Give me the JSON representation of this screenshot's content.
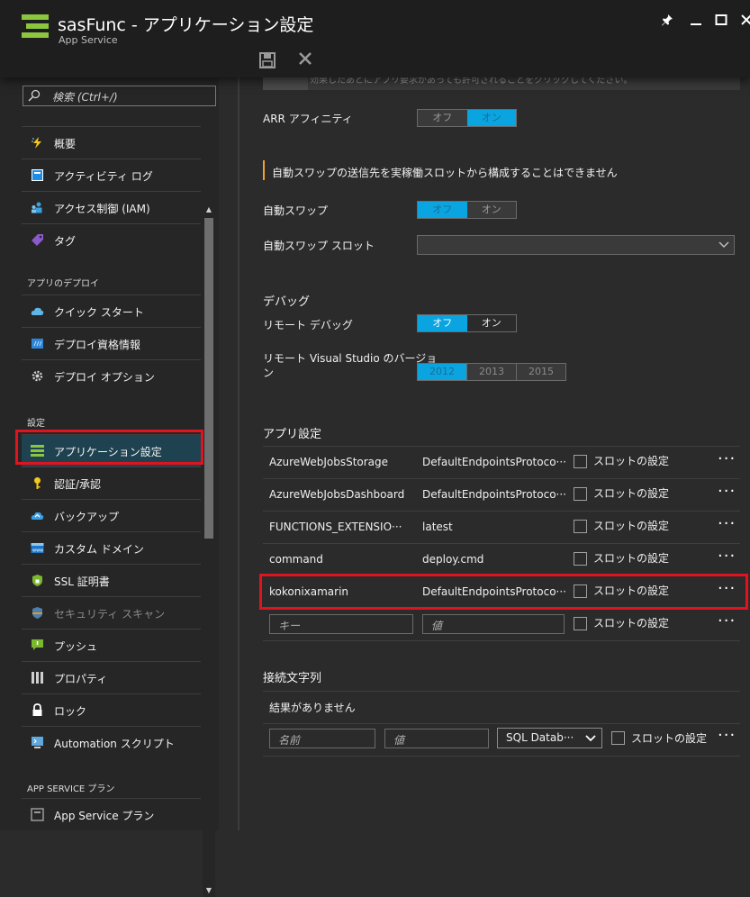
{
  "window": {
    "title": "sasFunc - アプリケーション設定",
    "subtitle": "App Service"
  },
  "search": {
    "placeholder": "検索 (Ctrl+/)"
  },
  "sidebar": {
    "items": [
      {
        "label": "概要",
        "icon": "lightning-icon"
      },
      {
        "label": "アクティビティ ログ",
        "icon": "activity-log-icon"
      },
      {
        "label": "アクセス制御 (IAM)",
        "icon": "users-icon"
      },
      {
        "label": "タグ",
        "icon": "tag-icon"
      }
    ],
    "section_deploy": "アプリのデプロイ",
    "deploy_items": [
      {
        "label": "クイック スタート",
        "icon": "cloud-icon"
      },
      {
        "label": "デプロイ資格情報",
        "icon": "credentials-icon"
      },
      {
        "label": "デプロイ オプション",
        "icon": "gear-icon"
      }
    ],
    "section_settings": "設定",
    "settings_items": [
      {
        "label": "アプリケーション設定",
        "icon": "app-settings-icon"
      },
      {
        "label": "認証/承認",
        "icon": "key-icon"
      },
      {
        "label": "バックアップ",
        "icon": "backup-cloud-icon"
      },
      {
        "label": "カスタム ドメイン",
        "icon": "domain-icon"
      },
      {
        "label": "SSL 証明書",
        "icon": "shield-icon"
      },
      {
        "label": "セキュリティ スキャン",
        "icon": "security-scan-icon"
      },
      {
        "label": "プッシュ",
        "icon": "push-icon"
      },
      {
        "label": "プロパティ",
        "icon": "properties-icon"
      },
      {
        "label": "ロック",
        "icon": "lock-icon"
      },
      {
        "label": "Automation スクリプト",
        "icon": "automation-icon"
      }
    ],
    "section_plan": "APP SERVICE プラン",
    "plan_items": [
      {
        "label": "App Service プラン",
        "icon": "plan-icon"
      }
    ]
  },
  "content": {
    "info_strip": "効果したあとにアプリ要求があっても許可されることをクリックしてください。",
    "arr_label": "ARR アフィニティ",
    "arr_toggle": {
      "off": "オフ",
      "on": "オン"
    },
    "autoswap_warning": "自動スワップの送信先を実稼働スロットから構成することはできません",
    "autoswap_label": "自動スワップ",
    "autoswap_toggle": {
      "off": "オフ",
      "on": "オン"
    },
    "autoswap_slot_label": "自動スワップ スロット",
    "debug_heading": "デバッグ",
    "remote_debug_label": "リモート デバッグ",
    "remote_debug_toggle": {
      "off": "オフ",
      "on": "オン"
    },
    "remote_vs_label_1": "リモート Visual Studio のバージョ",
    "remote_vs_label_2": "ン",
    "vs_versions": [
      "2012",
      "2013",
      "2015"
    ],
    "app_settings_heading": "アプリ設定",
    "slot_setting_label": "スロットの設定",
    "app_settings": [
      {
        "name": "AzureWebJobsStorage",
        "value": "DefaultEndpointsProtoco···"
      },
      {
        "name": "AzureWebJobsDashboard",
        "value": "DefaultEndpointsProtoco···"
      },
      {
        "name": "FUNCTIONS_EXTENSIO···",
        "value": "latest"
      },
      {
        "name": "command",
        "value": "deploy.cmd"
      },
      {
        "name": "kokonixamarin",
        "value": "DefaultEndpointsProtoco···"
      }
    ],
    "new_key_placeholder": "キー",
    "new_value_placeholder": "値",
    "conn_heading": "接続文字列",
    "conn_empty": "結果がありません",
    "conn_name_placeholder": "名前",
    "conn_value_placeholder": "値",
    "conn_type_selected": "SQL Datab···",
    "more_label": "···"
  },
  "colors": {
    "accent": "#0aa4e0",
    "highlight": "#e0141e",
    "warning": "#f0a030"
  }
}
